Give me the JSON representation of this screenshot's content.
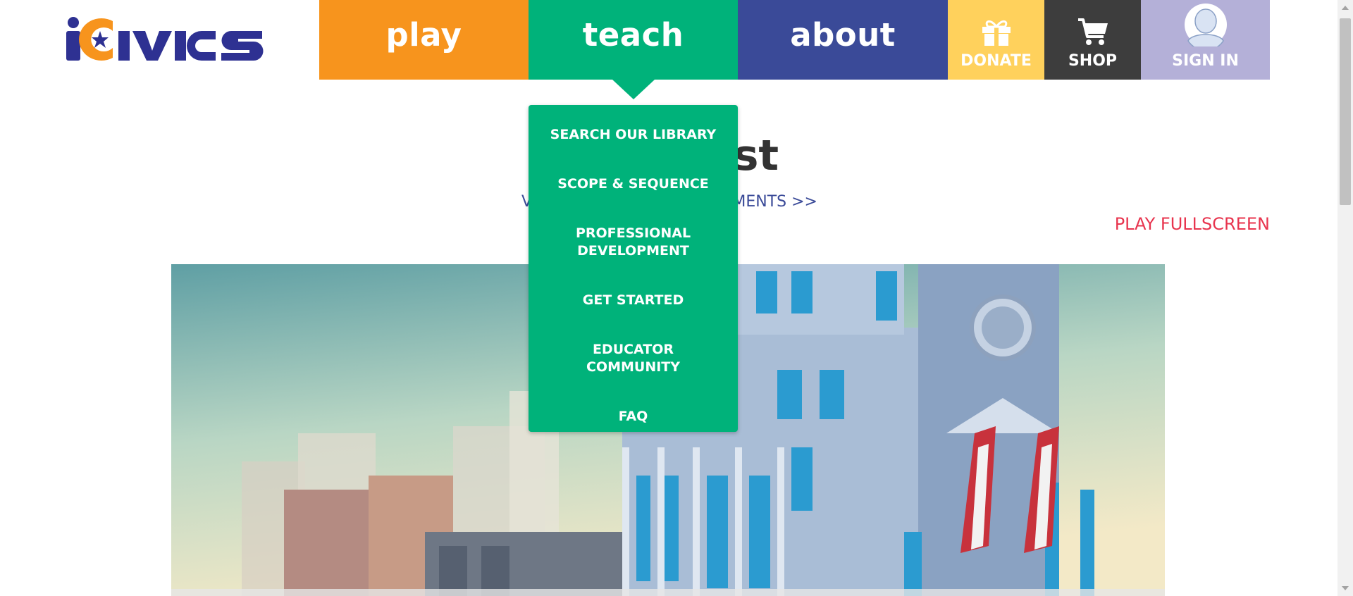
{
  "logo": {
    "text": "iCivics"
  },
  "nav": {
    "play": "play",
    "teach": "teach",
    "about": "about",
    "donate": "DONATE",
    "shop": "SHOP",
    "sign_in": "SIGN IN"
  },
  "teach_menu": [
    "SEARCH OUR LIBRARY",
    "SCOPE & SEQUENCE",
    "PROFESSIONAL DEVELOPMENT",
    "GET STARTED",
    "EDUCATOR COMMUNITY",
    "FAQ"
  ],
  "page": {
    "heading_visible": "est",
    "standards_left": "V",
    "standards_right": "EMENTS >>",
    "play_fullscreen": "PLAY FULLSCREEN"
  },
  "colors": {
    "play": "#f7941d",
    "teach": "#00b27a",
    "about": "#3a4a98",
    "donate": "#ffd15c",
    "shop": "#3d3d3d",
    "sign_in": "#b4b0d8",
    "fullscreen": "#e8344e"
  }
}
